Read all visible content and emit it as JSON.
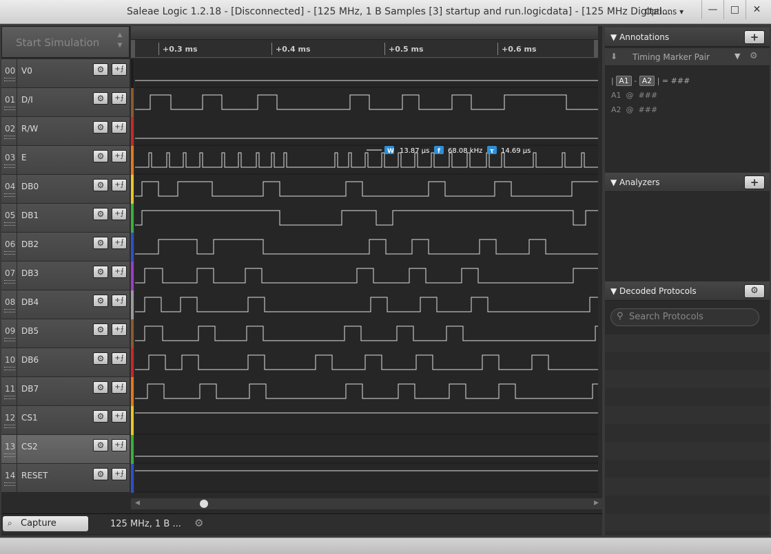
{
  "window": {
    "title": "Saleae Logic 1.2.18 - [Disconnected] - [125 MHz, 1 B Samples [3] startup and run.logicdata] - [125 MHz Digital...",
    "options_label": "Options ▾",
    "minimize": "—",
    "maximize": "□",
    "close": "✕"
  },
  "toolbar": {
    "start_simulation": "Start Simulation"
  },
  "ruler": {
    "ticks": [
      "+0.3 ms",
      "+0.4 ms",
      "+0.5 ms",
      "+0.6 ms"
    ]
  },
  "channels": [
    {
      "num": "00",
      "name": "V0",
      "color": "#1e1e1e"
    },
    {
      "num": "01",
      "name": "D/I",
      "color": "#8a5a2e"
    },
    {
      "num": "02",
      "name": "R/W",
      "color": "#c8282a"
    },
    {
      "num": "03",
      "name": "E",
      "color": "#e07a1e"
    },
    {
      "num": "04",
      "name": "DB0",
      "color": "#e8c62a"
    },
    {
      "num": "05",
      "name": "DB1",
      "color": "#3cae3c"
    },
    {
      "num": "06",
      "name": "DB2",
      "color": "#2e50c8"
    },
    {
      "num": "07",
      "name": "DB3",
      "color": "#9a3cc8"
    },
    {
      "num": "08",
      "name": "DB4",
      "color": "#9a9a9a"
    },
    {
      "num": "09",
      "name": "DB5",
      "color": "#8a5a2e"
    },
    {
      "num": "10",
      "name": "DB6",
      "color": "#c8282a"
    },
    {
      "num": "11",
      "name": "DB7",
      "color": "#e07a1e"
    },
    {
      "num": "12",
      "name": "CS1",
      "color": "#e8c62a"
    },
    {
      "num": "13",
      "name": "CS2",
      "color": "#3cae3c"
    },
    {
      "num": "14",
      "name": "RESET",
      "color": "#2e50c8"
    }
  ],
  "measurement": {
    "width_icon": "W",
    "width": "13.87 µs",
    "freq_icon": "f",
    "frequency": "68.08 kHz",
    "period_icon": "τ",
    "period": "14.69 µs"
  },
  "bottom_bar": {
    "capture_label": "Capture",
    "session_label": "125 MHz, 1 B ..."
  },
  "annotations": {
    "header": "Annotations",
    "add": "+",
    "marker_pair": "Timing Marker Pair",
    "a1": "A1",
    "a2": "A2",
    "placeholder": "###",
    "at": "@"
  },
  "analyzers": {
    "header": "Analyzers",
    "add": "+"
  },
  "decoded_protocols": {
    "header": "Decoded Protocols",
    "search_placeholder": "Search Protocols"
  }
}
